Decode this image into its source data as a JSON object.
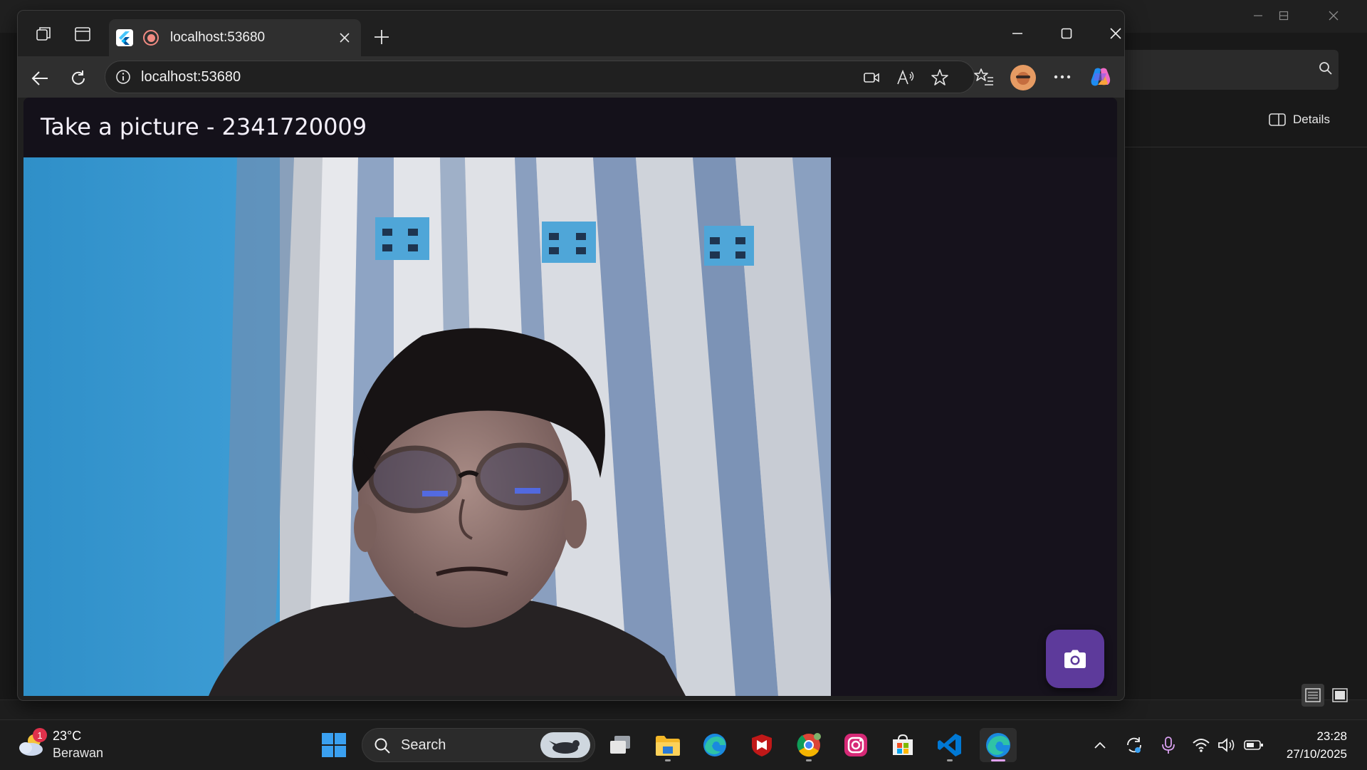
{
  "browser": {
    "tab_title": "localhost:53680",
    "address": "localhost:53680"
  },
  "page": {
    "app_title": "Take a picture - 2341720009",
    "fab_icon": "camera-icon"
  },
  "background_window": {
    "details_label": "Details"
  },
  "taskbar": {
    "weather_temp": "23°C",
    "weather_desc": "Berawan",
    "weather_badge": "1",
    "search_label": "Search",
    "time": "23:28",
    "date": "27/10/2025",
    "apps": [
      "task-view",
      "file-explorer",
      "edge",
      "mcafee",
      "chrome",
      "instagram",
      "microsoft-store",
      "vscode",
      "edge-active"
    ]
  },
  "colors": {
    "app_background": "#16121c",
    "fab": "#5d3a9b",
    "recording": "#f28b82"
  }
}
